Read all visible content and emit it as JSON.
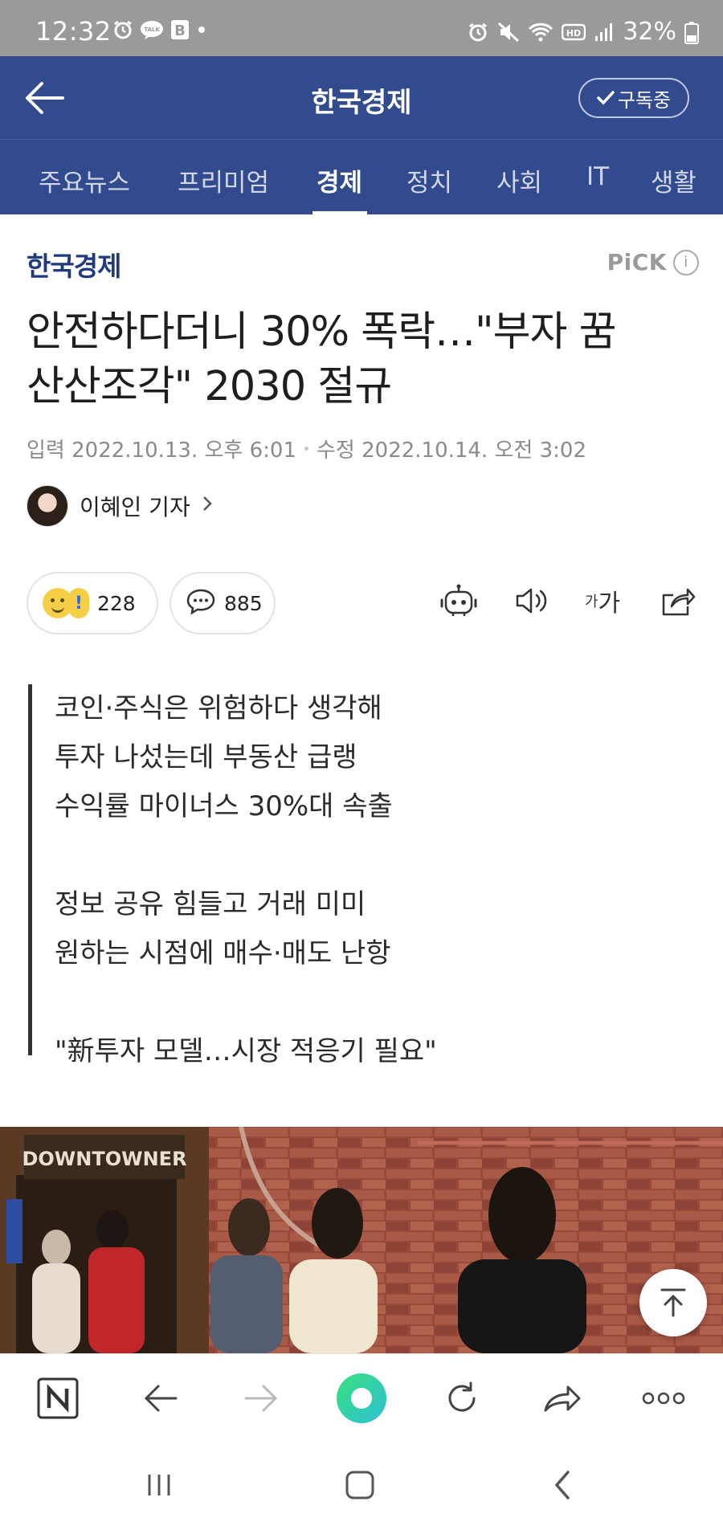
{
  "status_bar": {
    "time": "12:32",
    "battery": "32%",
    "left_icons": [
      "alarm-icon",
      "talk-icon",
      "b-app-icon",
      "dot-icon"
    ],
    "right_icons": [
      "alarm-icon",
      "mute-icon",
      "wifi-icon",
      "hd-icon",
      "signal-icon",
      "battery-icon"
    ]
  },
  "header": {
    "title": "한국경제",
    "subscribe_label": "구독중"
  },
  "tabs": [
    {
      "label": "주요뉴스",
      "active": false
    },
    {
      "label": "프리미엄",
      "active": false
    },
    {
      "label": "경제",
      "active": true
    },
    {
      "label": "정치",
      "active": false
    },
    {
      "label": "사회",
      "active": false
    },
    {
      "label": "IT",
      "active": false
    },
    {
      "label": "생활",
      "active": false
    }
  ],
  "article": {
    "press": "한국경제",
    "pick_label": "PiCK",
    "headline_line1": "안전하다더니 30% 폭락…\"부자 꿈",
    "headline_line2": "산산조각\" 2030 절규",
    "published": "입력 2022.10.13. 오후 6:01",
    "modified": "수정 2022.10.14. 오전 3:02",
    "reporter": "이혜인 기자",
    "reaction_count": "228",
    "comment_count": "885",
    "font_size_label_small": "가",
    "font_size_label_large": "가",
    "summary": [
      "코인·주식은 위험하다 생각해",
      "투자 나섰는데 부동산 급랭",
      "수익률 마이너스 30%대 속출",
      "",
      "정보 공유 힘들고 거래 미미",
      "원하는 시점에 매수·매도 난항",
      "",
      "\"新투자 모델…시장 적응기 필요\""
    ],
    "photo_sign": "DOWNTOWNER"
  },
  "colors": {
    "header_bg": "#324a8e",
    "status_bg": "#9a9a9a",
    "press_logo": "#1f3a7d"
  }
}
